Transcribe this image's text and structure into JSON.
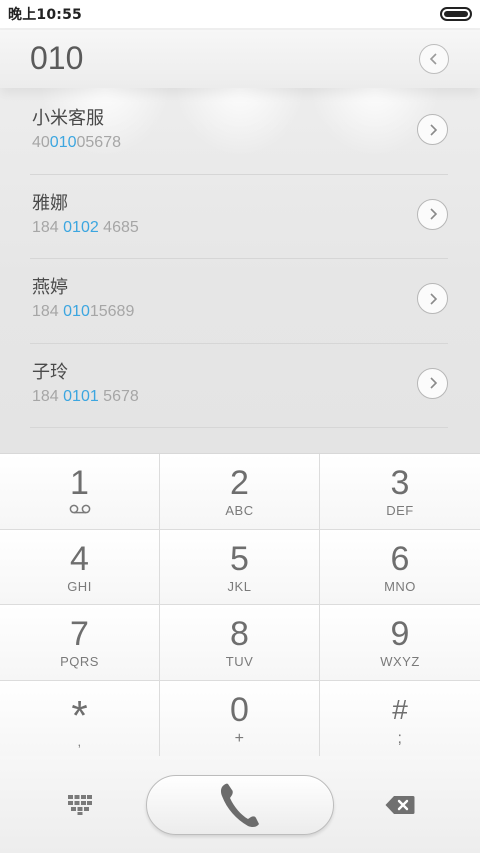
{
  "status_bar": {
    "time": "晚上10:55",
    "battery_level": 1.0
  },
  "dialer": {
    "input_number": "010"
  },
  "contacts": [
    {
      "name": "小米客服",
      "number_pre": "40",
      "number_match": "010",
      "number_post": "05678"
    },
    {
      "name": "雅娜",
      "number_pre": "184 ",
      "number_match": "0102",
      "number_post": " 4685"
    },
    {
      "name": "燕婷",
      "number_pre": "184 ",
      "number_match": "010",
      "number_post": "15689"
    },
    {
      "name": "子玲",
      "number_pre": "184 ",
      "number_match": "0101",
      "number_post": " 5678"
    }
  ],
  "keypad": [
    {
      "digit": "1",
      "letters": ""
    },
    {
      "digit": "2",
      "letters": "ABC"
    },
    {
      "digit": "3",
      "letters": "DEF"
    },
    {
      "digit": "4",
      "letters": "GHI"
    },
    {
      "digit": "5",
      "letters": "JKL"
    },
    {
      "digit": "6",
      "letters": "MNO"
    },
    {
      "digit": "7",
      "letters": "PQRS"
    },
    {
      "digit": "8",
      "letters": "TUV"
    },
    {
      "digit": "9",
      "letters": "WXYZ"
    },
    {
      "digit": "*",
      "letters": ","
    },
    {
      "digit": "0",
      "letters": "+"
    },
    {
      "digit": "#",
      "letters": ";"
    }
  ],
  "icons": {
    "voicemail": "voicemail-icon",
    "back": "chevron-left-icon",
    "detail": "chevron-right-icon",
    "dialpad": "dialpad-icon",
    "call": "phone-icon",
    "delete": "backspace-icon"
  },
  "colors": {
    "highlight": "#3ca6e0",
    "text": "#4a4a4a",
    "secondary": "#a6a6a6"
  }
}
